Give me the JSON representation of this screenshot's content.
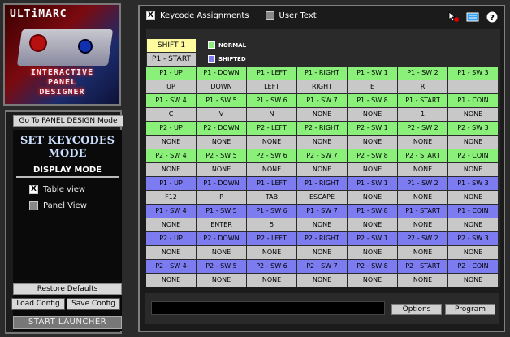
{
  "logo": {
    "brand": "ULTiMARC",
    "tagline": [
      "INTERACTIVE",
      "PANEL",
      "DESIGNER"
    ]
  },
  "left_panel": {
    "mode_button": "Go To PANEL DESIGN Mode",
    "title_line1": "SET KEYCODES",
    "title_line2": "MODE",
    "display_mode": "DISPLAY MODE",
    "table_view": {
      "label": "Table view",
      "checked": true
    },
    "panel_view": {
      "label": "Panel View",
      "checked": false
    },
    "restore": "Restore Defaults",
    "load": "Load Config",
    "save": "Save Config",
    "launcher": "START  LAUNCHER"
  },
  "topbar": {
    "keycode_assignments": "Keycode Assignments",
    "keycode_checked": true,
    "user_text": "User Text",
    "user_text_checked": false
  },
  "legend": {
    "shift_label": "SHIFT 1",
    "p1start_label": "P1 - START",
    "normal": "NORMAL",
    "shifted": "SHIFTED",
    "normal_color": "#8af07a",
    "shifted_color": "#7c7cf0"
  },
  "table": {
    "rows": [
      {
        "type": "hdr-green",
        "cells": [
          "P1 - UP",
          "P1 - DOWN",
          "P1 - LEFT",
          "P1 - RIGHT",
          "P1 - SW 1",
          "P1 - SW 2",
          "P1 - SW 3"
        ]
      },
      {
        "type": "val",
        "cells": [
          "UP",
          "DOWN",
          "LEFT",
          "RIGHT",
          "E",
          "R",
          "T"
        ]
      },
      {
        "type": "hdr-green",
        "cells": [
          "P1 - SW 4",
          "P1 - SW 5",
          "P1 - SW 6",
          "P1 - SW 7",
          "P1 - SW 8",
          "P1 - START",
          "P1 - COIN"
        ]
      },
      {
        "type": "val",
        "cells": [
          "C",
          "V",
          "N",
          "NONE",
          "NONE",
          "1",
          "NONE"
        ]
      },
      {
        "type": "hdr-green",
        "cells": [
          "P2 - UP",
          "P2 - DOWN",
          "P2 - LEFT",
          "P2 - RIGHT",
          "P2 - SW 1",
          "P2 - SW 2",
          "P2 - SW 3"
        ]
      },
      {
        "type": "val",
        "cells": [
          "NONE",
          "NONE",
          "NONE",
          "NONE",
          "NONE",
          "NONE",
          "NONE"
        ]
      },
      {
        "type": "hdr-green",
        "cells": [
          "P2 - SW 4",
          "P2 - SW 5",
          "P2 - SW 6",
          "P2 - SW 7",
          "P2 - SW 8",
          "P2 - START",
          "P2 - COIN"
        ]
      },
      {
        "type": "val",
        "cells": [
          "NONE",
          "NONE",
          "NONE",
          "NONE",
          "NONE",
          "NONE",
          "NONE"
        ]
      },
      {
        "type": "hdr-blue",
        "cells": [
          "P1 - UP",
          "P1 - DOWN",
          "P1 - LEFT",
          "P1 - RIGHT",
          "P1 - SW 1",
          "P1 - SW 2",
          "P1 - SW 3"
        ]
      },
      {
        "type": "val",
        "cells": [
          "F12",
          "P",
          "TAB",
          "ESCAPE",
          "NONE",
          "NONE",
          "NONE"
        ]
      },
      {
        "type": "hdr-blue",
        "cells": [
          "P1 - SW 4",
          "P1 - SW 5",
          "P1 - SW 6",
          "P1 - SW 7",
          "P1 - SW 8",
          "P1 - START",
          "P1 - COIN"
        ]
      },
      {
        "type": "val",
        "cells": [
          "NONE",
          "ENTER",
          "5",
          "NONE",
          "NONE",
          "NONE",
          "NONE"
        ]
      },
      {
        "type": "hdr-blue",
        "cells": [
          "P2 - UP",
          "P2 - DOWN",
          "P2 - LEFT",
          "P2 - RIGHT",
          "P2 - SW 1",
          "P2 - SW 2",
          "P2 - SW 3"
        ]
      },
      {
        "type": "val",
        "cells": [
          "NONE",
          "NONE",
          "NONE",
          "NONE",
          "NONE",
          "NONE",
          "NONE"
        ]
      },
      {
        "type": "hdr-blue",
        "cells": [
          "P2 - SW 4",
          "P2 - SW 5",
          "P2 - SW 6",
          "P2 - SW 7",
          "P2 - SW 8",
          "P2 - START",
          "P2 - COIN"
        ]
      },
      {
        "type": "val",
        "cells": [
          "NONE",
          "NONE",
          "NONE",
          "NONE",
          "NONE",
          "NONE",
          "NONE"
        ]
      }
    ]
  },
  "bottom": {
    "input_value": "",
    "options": "Options",
    "program": "Program"
  },
  "icons": {
    "cursor": "pointer-hand-icon",
    "message": "message-icon",
    "help": "help-icon"
  }
}
